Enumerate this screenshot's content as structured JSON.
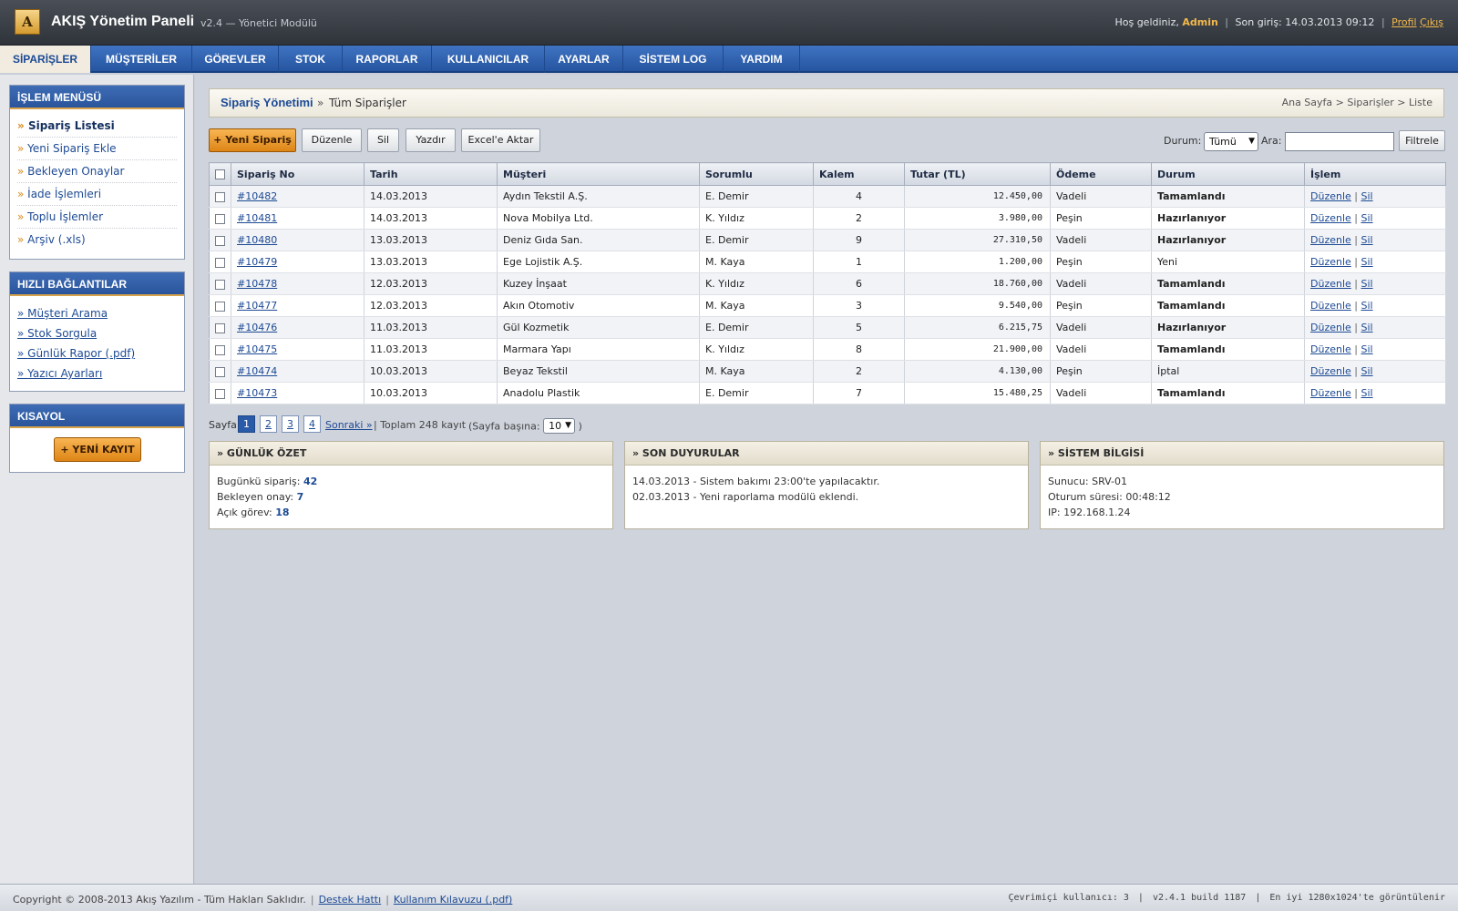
{
  "header": {
    "logo_letter": "A",
    "title": "AKIŞ Yönetim Paneli",
    "version": "v2.4 — Yönetici Modülü",
    "welcome": "Hoş geldiniz,",
    "username": "Admin",
    "last_login": "Son giriş: 14.03.2013 09:12",
    "profile_link": "Profil",
    "logout_link": "Çıkış"
  },
  "nav": {
    "tabs": [
      {
        "label": "SİPARİŞLER",
        "active": true
      },
      {
        "label": "MÜŞTERİLER"
      },
      {
        "label": "GÖREVLER"
      },
      {
        "label": "STOK"
      },
      {
        "label": "RAPORLAR"
      },
      {
        "label": "KULLANICILAR"
      },
      {
        "label": "AYARLAR"
      },
      {
        "label": "SİSTEM LOG"
      },
      {
        "label": "YARDIM"
      }
    ]
  },
  "sidebar": {
    "menu_title": "İŞLEM MENÜSÜ",
    "menu_items": [
      {
        "label": "Sipariş Listesi",
        "current": true
      },
      {
        "label": "Yeni Sipariş Ekle"
      },
      {
        "label": "Bekleyen Onaylar"
      },
      {
        "label": "İade İşlemleri"
      },
      {
        "label": "Toplu İşlemler"
      },
      {
        "label": "Arşiv (.xls)"
      }
    ],
    "quick_title": "HIZLI BAĞLANTILAR",
    "quick_links": [
      {
        "label": "Müşteri Arama"
      },
      {
        "label": "Stok Sorgula"
      },
      {
        "label": "Günlük Rapor (.pdf)"
      },
      {
        "label": "Yazıcı Ayarları"
      }
    ],
    "shortcut_title": "KISAYOL",
    "shortcut_button": "+ YENİ KAYIT"
  },
  "breadcrumb": {
    "title": "Sipariş Yönetimi",
    "separator": "»",
    "subtitle": "Tüm Siparişler",
    "path": "Ana Sayfa > Siparişler > Liste"
  },
  "toolbar": {
    "new_order": "+ Yeni Sipariş",
    "edit": "Düzenle",
    "delete": "Sil",
    "print": "Yazdır",
    "export": "Excel'e Aktar",
    "status_label": "Durum:",
    "status_value": "Tümü",
    "search_label": "Ara:",
    "search_value": "",
    "filter_button": "Filtrele"
  },
  "table": {
    "columns": [
      "Sipariş No",
      "Tarih",
      "Müşteri",
      "Sorumlu",
      "Kalem",
      "Tutar (TL)",
      "Ödeme",
      "Durum",
      "İşlem"
    ],
    "edit_label": "Düzenle",
    "delete_label": "Sil",
    "action_separator": "|",
    "rows": [
      {
        "no": "#10482",
        "date": "14.03.2013",
        "customer": "Aydın Tekstil A.Ş.",
        "owner": "E. Demir",
        "items": "4",
        "amount": "12.450,00",
        "payment": "Vadeli",
        "status": "Tamamlandı",
        "status_bold": true
      },
      {
        "no": "#10481",
        "date": "14.03.2013",
        "customer": "Nova Mobilya Ltd.",
        "owner": "K. Yıldız",
        "items": "2",
        "amount": "3.980,00",
        "payment": "Peşin",
        "status": "Hazırlanıyor",
        "status_bold": true
      },
      {
        "no": "#10480",
        "date": "13.03.2013",
        "customer": "Deniz Gıda San.",
        "owner": "E. Demir",
        "items": "9",
        "amount": "27.310,50",
        "payment": "Vadeli",
        "status": "Hazırlanıyor",
        "status_bold": true
      },
      {
        "no": "#10479",
        "date": "13.03.2013",
        "customer": "Ege Lojistik A.Ş.",
        "owner": "M. Kaya",
        "items": "1",
        "amount": "1.200,00",
        "payment": "Peşin",
        "status": "Yeni",
        "status_bold": false
      },
      {
        "no": "#10478",
        "date": "12.03.2013",
        "customer": "Kuzey İnşaat",
        "owner": "K. Yıldız",
        "items": "6",
        "amount": "18.760,00",
        "payment": "Vadeli",
        "status": "Tamamlandı",
        "status_bold": true
      },
      {
        "no": "#10477",
        "date": "12.03.2013",
        "customer": "Akın Otomotiv",
        "owner": "M. Kaya",
        "items": "3",
        "amount": "9.540,00",
        "payment": "Peşin",
        "status": "Tamamlandı",
        "status_bold": true
      },
      {
        "no": "#10476",
        "date": "11.03.2013",
        "customer": "Gül Kozmetik",
        "owner": "E. Demir",
        "items": "5",
        "amount": "6.215,75",
        "payment": "Vadeli",
        "status": "Hazırlanıyor",
        "status_bold": true
      },
      {
        "no": "#10475",
        "date": "11.03.2013",
        "customer": "Marmara Yapı",
        "owner": "K. Yıldız",
        "items": "8",
        "amount": "21.900,00",
        "payment": "Vadeli",
        "status": "Tamamlandı",
        "status_bold": true
      },
      {
        "no": "#10474",
        "date": "10.03.2013",
        "customer": "Beyaz Tekstil",
        "owner": "M. Kaya",
        "items": "2",
        "amount": "4.130,00",
        "payment": "Peşin",
        "status": "İptal",
        "status_bold": false
      },
      {
        "no": "#10473",
        "date": "10.03.2013",
        "customer": "Anadolu Plastik",
        "owner": "E. Demir",
        "items": "7",
        "amount": "15.480,25",
        "payment": "Vadeli",
        "status": "Tamamlandı",
        "status_bold": true
      }
    ]
  },
  "pagination": {
    "label": "Sayfa:",
    "pages": [
      "1",
      "2",
      "3",
      "4"
    ],
    "current": "1",
    "next": "Sonraki »",
    "total": "|  Toplam 248 kayıt",
    "per_page_label": "(Sayfa başına:",
    "per_page_value": "10",
    "per_page_close": ")"
  },
  "boxes": {
    "daily": {
      "title": "» GÜNLÜK ÖZET",
      "lines": [
        {
          "label": "Bugünkü sipariş:",
          "value": "42"
        },
        {
          "label": "Bekleyen onay:",
          "value": "7"
        },
        {
          "label": "Açık görev:",
          "value": "18"
        }
      ]
    },
    "news": {
      "title": "» SON DUYURULAR",
      "lines": [
        "14.03.2013 - Sistem bakımı 23:00'te yapılacaktır.",
        "02.03.2013 - Yeni raporlama modülü eklendi."
      ]
    },
    "system": {
      "title": "» SİSTEM BİLGİSİ",
      "lines": [
        "Sunucu: SRV-01",
        "Oturum süresi: 00:48:12",
        "IP: 192.168.1.24"
      ]
    }
  },
  "footer": {
    "copyright": "Copyright © 2008-2013 Akış Yazılım - Tüm Hakları Saklıdır.",
    "support_link": "Destek Hattı",
    "manual_link": "Kullanım Kılavuzu (.pdf)",
    "online_users": "Çevrimiçi kullanıcı: 3",
    "build": "v2.4.1 build 1187",
    "resolution_note": "En iyi 1280x1024'te görüntülenir"
  }
}
